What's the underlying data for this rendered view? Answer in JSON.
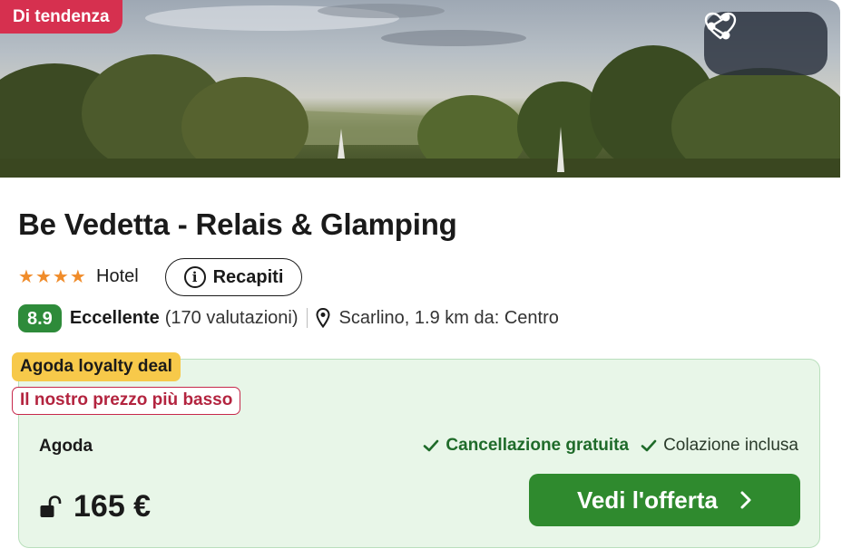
{
  "hero": {
    "badge": "Di tendenza",
    "share_icon": "share-icon",
    "favorite_icon": "heart-icon"
  },
  "hotel": {
    "name": "Be Vedetta - Relais & Glamping",
    "stars": 4,
    "type": "Hotel",
    "contacts_label": "Recapiti"
  },
  "rating": {
    "score": "8.9",
    "word": "Eccellente",
    "count": "(170 valutazioni)",
    "location": "Scarlino, 1.9 km da: Centro"
  },
  "deal": {
    "loyalty_label": "Agoda loyalty deal",
    "lowest_label": "Il nostro prezzo più basso",
    "provider": "Agoda",
    "perks": [
      "Cancellazione gratuita",
      "Colazione inclusa"
    ],
    "price": "165 €",
    "cta_label": "Vedi l'offerta"
  },
  "colors": {
    "trend_badge": "#d6304f",
    "score_badge": "#2e8b3a",
    "star": "#f08c2a",
    "deal_bg": "#e8f6e8",
    "loyalty_badge": "#f7c94a",
    "cta": "#2f8a2e"
  }
}
